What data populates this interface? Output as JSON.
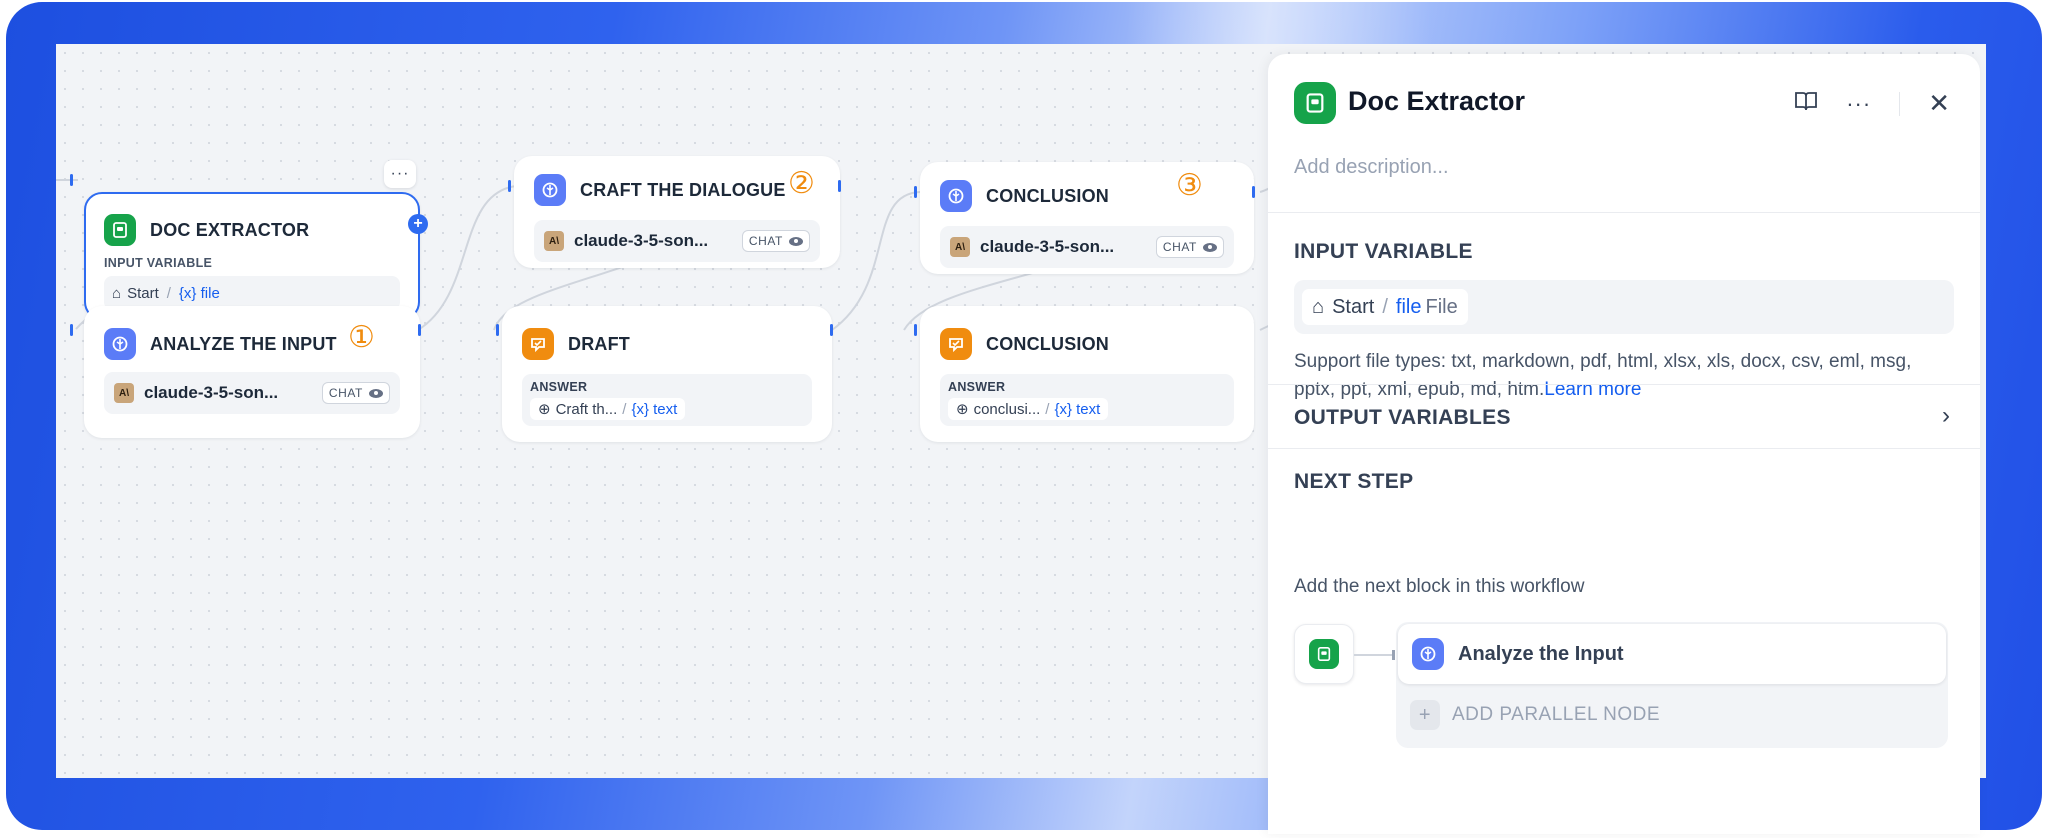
{
  "canvas": {
    "nodes": {
      "doc_extractor": {
        "title": "DOC EXTRACTOR",
        "input_label": "INPUT VARIABLE",
        "start": "Start",
        "var": "{x} file"
      },
      "analyze": {
        "title": "ANALYZE THE INPUT",
        "badge": "①",
        "model": "claude-3-5-son...",
        "tag": "CHAT"
      },
      "craft": {
        "title": "CRAFT THE DIALOGUE",
        "badge": "②",
        "model": "claude-3-5-son...",
        "tag": "CHAT"
      },
      "draft": {
        "title": "DRAFT",
        "answer_label": "ANSWER",
        "source": "Craft th...",
        "var": "{x} text"
      },
      "conclusion_llm": {
        "title": "CONCLUSION",
        "badge": "③",
        "model": "claude-3-5-son...",
        "tag": "CHAT"
      },
      "conclusion_answer": {
        "title": "CONCLUSION",
        "answer_label": "ANSWER",
        "source": "conclusi...",
        "var": "{x} text"
      }
    },
    "more_button": "···"
  },
  "panel": {
    "title": "Doc Extractor",
    "description_placeholder": "Add description...",
    "input_variable": {
      "title": "INPUT VARIABLE",
      "start": "Start",
      "var": "file",
      "type": "File"
    },
    "support_text": "Support file types: txt, markdown, pdf, html, xlsx, xls, docx, csv, eml, msg, pptx, ppt, xml, epub, md, htm.",
    "learn_more": "Learn more",
    "output_variables": "OUTPUT VARIABLES",
    "next_step": {
      "title": "NEXT STEP",
      "subtitle": "Add the next block in this workflow",
      "item": "Analyze the Input",
      "add_parallel": "ADD PARALLEL NODE"
    }
  },
  "colors": {
    "accent": "#2e6bf0",
    "green_icon": "#16a34a",
    "blue_icon": "#5b7cf7",
    "orange_icon": "#f08c0f"
  }
}
